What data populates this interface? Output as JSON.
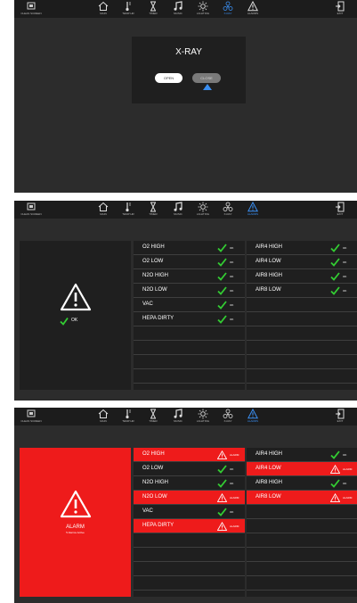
{
  "colors": {
    "panel": "#2c2c2c",
    "navbar": "#1c1c1c",
    "card": "#1f1f1f",
    "alarm_red": "#ee1b1b",
    "ok_green": "#33cc33",
    "active_blue": "#3a8ef0"
  },
  "nav": {
    "clean_screen": "CLEAN SCREEN",
    "main": "MAIN",
    "temp_hr": "TEMP HR",
    "timer": "TIMER",
    "music": "MUSIC",
    "lighting": "LIGHTING",
    "x_ray": "X-RAY",
    "alarms": "ALARMS",
    "exit": "EXIT"
  },
  "xray": {
    "title": "X-RAY",
    "open_label": "OPEN",
    "close_label": "CLOSE"
  },
  "alarm_panel_ok": {
    "summary_status": "OK",
    "left": [
      {
        "name": "O2 HIGH",
        "status": "OK"
      },
      {
        "name": "O2 LOW",
        "status": "OK"
      },
      {
        "name": "N2O HIGH",
        "status": "OK"
      },
      {
        "name": "N2O LOW",
        "status": "OK"
      },
      {
        "name": "VAC",
        "status": "OK"
      },
      {
        "name": "HEPA DIRTY",
        "status": "OK"
      }
    ],
    "right": [
      {
        "name": "AIR4 HIGH",
        "status": "OK"
      },
      {
        "name": "AIR4 LOW",
        "status": "OK"
      },
      {
        "name": "AIR8 HIGH",
        "status": "OK"
      },
      {
        "name": "AIR8 LOW",
        "status": "OK"
      }
    ]
  },
  "alarm_panel_alarm": {
    "summary_title": "ALARM",
    "summary_subtitle": "5 Alarms Active",
    "left": [
      {
        "name": "O2 HIGH",
        "status": "ALARM"
      },
      {
        "name": "O2 LOW",
        "status": "OK"
      },
      {
        "name": "N2O HIGH",
        "status": "OK"
      },
      {
        "name": "N2O LOW",
        "status": "ALARM"
      },
      {
        "name": "VAC",
        "status": "OK"
      },
      {
        "name": "HEPA DIRTY",
        "status": "ALARM"
      }
    ],
    "right": [
      {
        "name": "AIR4 HIGH",
        "status": "OK"
      },
      {
        "name": "AIR4 LOW",
        "status": "ALARM"
      },
      {
        "name": "AIR8 HIGH",
        "status": "OK"
      },
      {
        "name": "AIR8 LOW",
        "status": "ALARM"
      }
    ]
  }
}
